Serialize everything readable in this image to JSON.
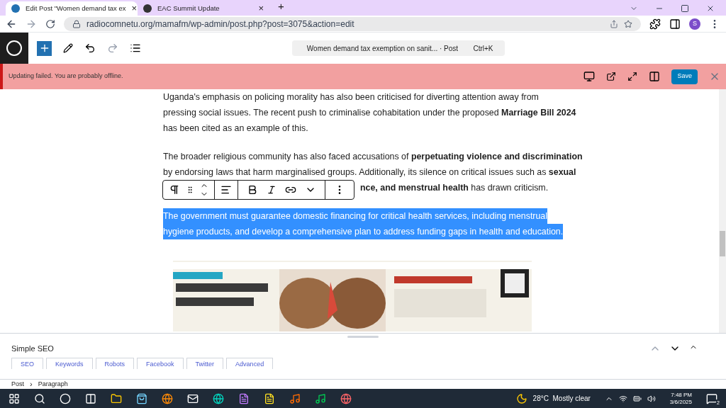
{
  "browser": {
    "tabs": [
      {
        "title": "Edit Post \"Women demand tax ex",
        "selected": true,
        "close": "×"
      },
      {
        "title": "EAC Summit Update",
        "selected": false,
        "close": "×"
      }
    ],
    "new_tab": "+",
    "url": "radiocomnetu.org/mamafm/wp-admin/post.php?post=3075&action=edit",
    "profile": "S"
  },
  "editor": {
    "command_bar": {
      "title": "Women demand tax exemption on sanit... · Post",
      "shortcut": "Ctrl+K"
    },
    "notice": "Updating failed. You are probably offline.",
    "save": "Save",
    "paragraphs": [
      {
        "lines": [
          "Uganda's emphasis on policing morality has also been criticised for diverting attention away from",
          "pressing social issues. The recent push to criminalise cohabitation under the proposed **Marriage Bill 2024**",
          "has been cited as an example of this."
        ],
        "selected": false
      },
      {
        "lines": [
          "The broader religious community has also faced accusations of **perpetuating violence and discrimination**",
          "by endorsing laws that harm marginalised groups. Additionally, its silence on critical issues such as **sexual**",
          "**nce, and menstrual health** has drawn criticism."
        ],
        "selected": false
      },
      {
        "lines": [
          "The government must guarantee domestic financing for critical health services, including menstrual",
          "hygiene products, and develop a comprehensive plan to address funding gaps in health and education."
        ],
        "selected": true
      }
    ],
    "image": {
      "kind": "picture"
    },
    "metabox": {
      "title": "Simple SEO",
      "tabs": [
        "SEO",
        "Keywords",
        "Robots",
        "Facebook",
        "Twitter",
        "Advanced"
      ]
    },
    "breadcrumb": [
      "Post",
      "Paragraph"
    ],
    "breadcrumb_separator": "›"
  },
  "taskbar": {
    "weather": "28°C  Mostly clear",
    "time": "7:48 PM",
    "date": "3/6/2025",
    "notifications": "2"
  }
}
